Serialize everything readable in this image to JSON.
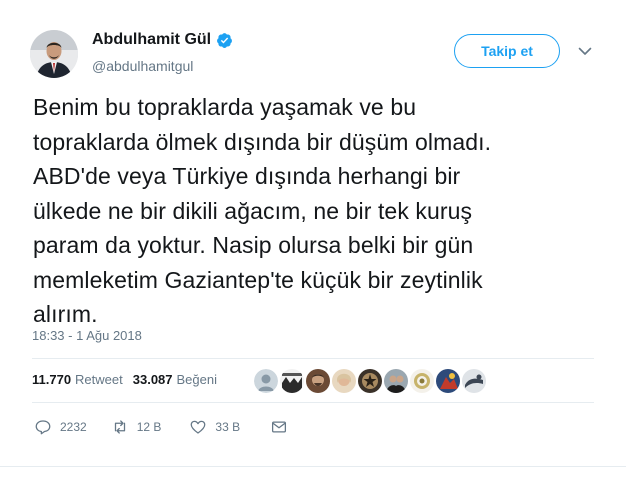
{
  "user": {
    "display_name": "Abdulhamit Gül",
    "handle": "@abdulhamitgul",
    "verified": true,
    "avatar_icon": "profile-photo"
  },
  "follow_button": {
    "label": "Takip et"
  },
  "menu_icon": "chevron-down-icon",
  "tweet": {
    "text": "Benim bu topraklarda yaşamak ve bu\ntopraklarda ölmek dışında bir düşüm olmadı.\nABD'de veya Türkiye dışında herhangi bir\nülkede ne bir dikili ağacım, ne bir tek kuruş\nparam da yoktur. Nasip olursa belki bir gün\nmemleketim Gaziantep'te küçük bir zeytinlik\nalırım.",
    "timestamp": "18:33 - 1 Ağu 2018"
  },
  "stats": {
    "retweets_count": "11.770",
    "retweets_label": "Retweet",
    "likes_count": "33.087",
    "likes_label": "Beğeni"
  },
  "likers_count_shown": 9,
  "actions": {
    "replies": "2232",
    "retweets": "12 B",
    "likes": "33 B"
  },
  "colors": {
    "accent": "#1da1f2",
    "secondary_text": "#657786",
    "divider": "#e6ecf0"
  }
}
